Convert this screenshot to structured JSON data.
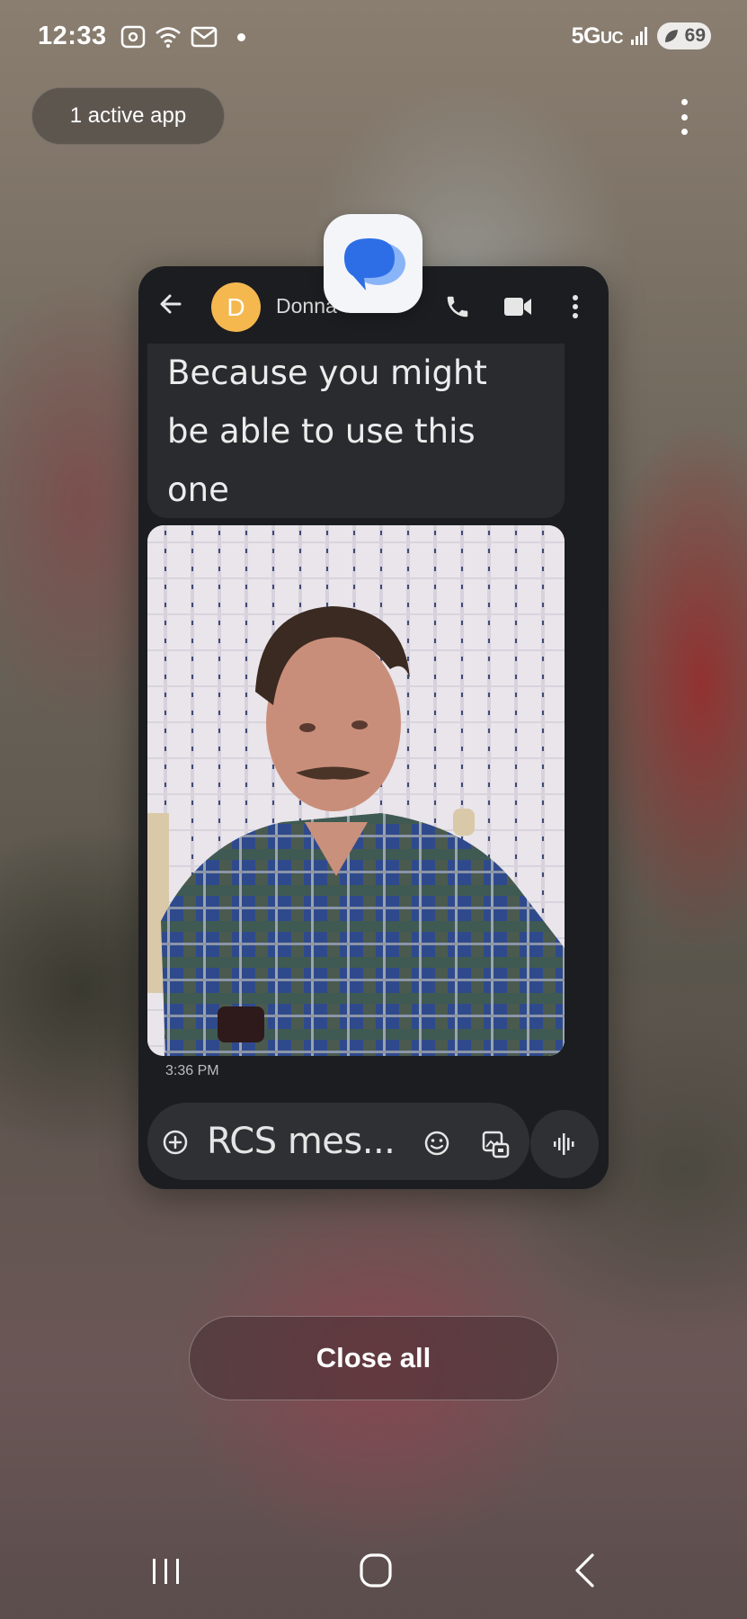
{
  "status_bar": {
    "time": "12:33",
    "network": "5G",
    "network_suffix": "UC",
    "battery": "69"
  },
  "recents": {
    "active_apps_label": "1 active app",
    "close_all_label": "Close all"
  },
  "app_card": {
    "app_name_icon": "messages-icon",
    "contact": {
      "avatar_letter": "D",
      "name": "Donna"
    },
    "message_text_lines": [
      "Because you might",
      "be able to use this",
      "one"
    ],
    "timestamp": "3:36 PM",
    "compose_placeholder": "RCS mes..."
  },
  "colors": {
    "avatar_bg": "#f4b84f",
    "card_bg": "#1c1d20",
    "bubble_bg": "#2a2b2f",
    "messages_blue": "#2d6ee6"
  }
}
